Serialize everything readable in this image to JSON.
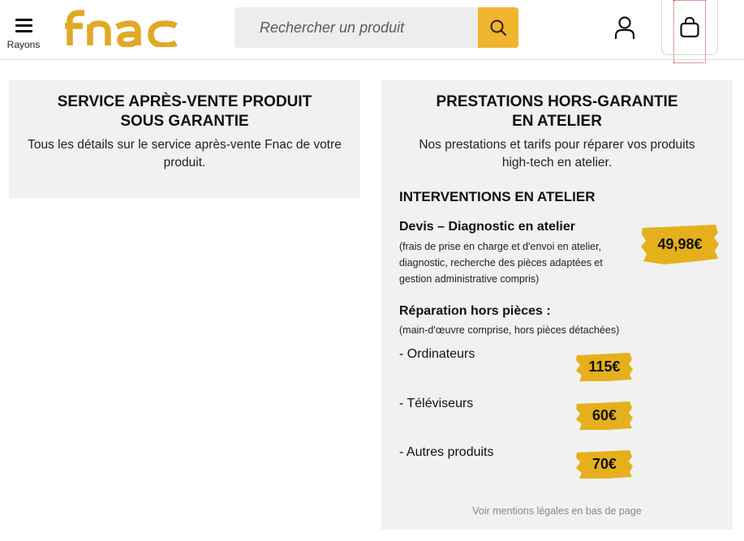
{
  "header": {
    "menu_label": "Rayons",
    "logo_text": "fnac",
    "search_placeholder": "Rechercher un produit",
    "icons": {
      "menu": "hamburger-icon",
      "search": "search-icon",
      "account": "user-icon",
      "cart": "shopping-bag-icon"
    }
  },
  "colors": {
    "brand": "#e1a925",
    "search_button": "#f1b42f",
    "price_tag": "#e5b01c",
    "card_background": "#f1f1f1"
  },
  "card_left": {
    "title_line1": "SERVICE APRÈS-VENTE PRODUIT",
    "title_line2": "SOUS GARANTIE",
    "description": "Tous les détails sur le service après-vente Fnac de votre produit."
  },
  "card_right": {
    "title_line1": "PRESTATIONS HORS-GARANTIE",
    "title_line2": "EN ATELIER",
    "description": "Nos prestations et tarifs pour réparer vos produits high-tech en atelier.",
    "section_title": "INTERVENTIONS EN ATELIER",
    "devis": {
      "title": "Devis – Diagnostic en atelier",
      "note_lines": [
        "(frais de prise en charge et d'envoi en atelier,",
        "diagnostic, recherche des pièces adaptées et",
        "gestion administrative compris)"
      ],
      "price": "49,98€"
    },
    "repair": {
      "title": "Réparation hors pièces :",
      "note": "(main-d'œuvre comprise, hors pièces détachées)",
      "items": [
        {
          "label": "- Ordinateurs",
          "price": "115€"
        },
        {
          "label": "- Téléviseurs",
          "price": "60€"
        },
        {
          "label": "- Autres produits",
          "price": "70€"
        }
      ]
    },
    "legal_link": "Voir mentions légales en bas de page"
  }
}
